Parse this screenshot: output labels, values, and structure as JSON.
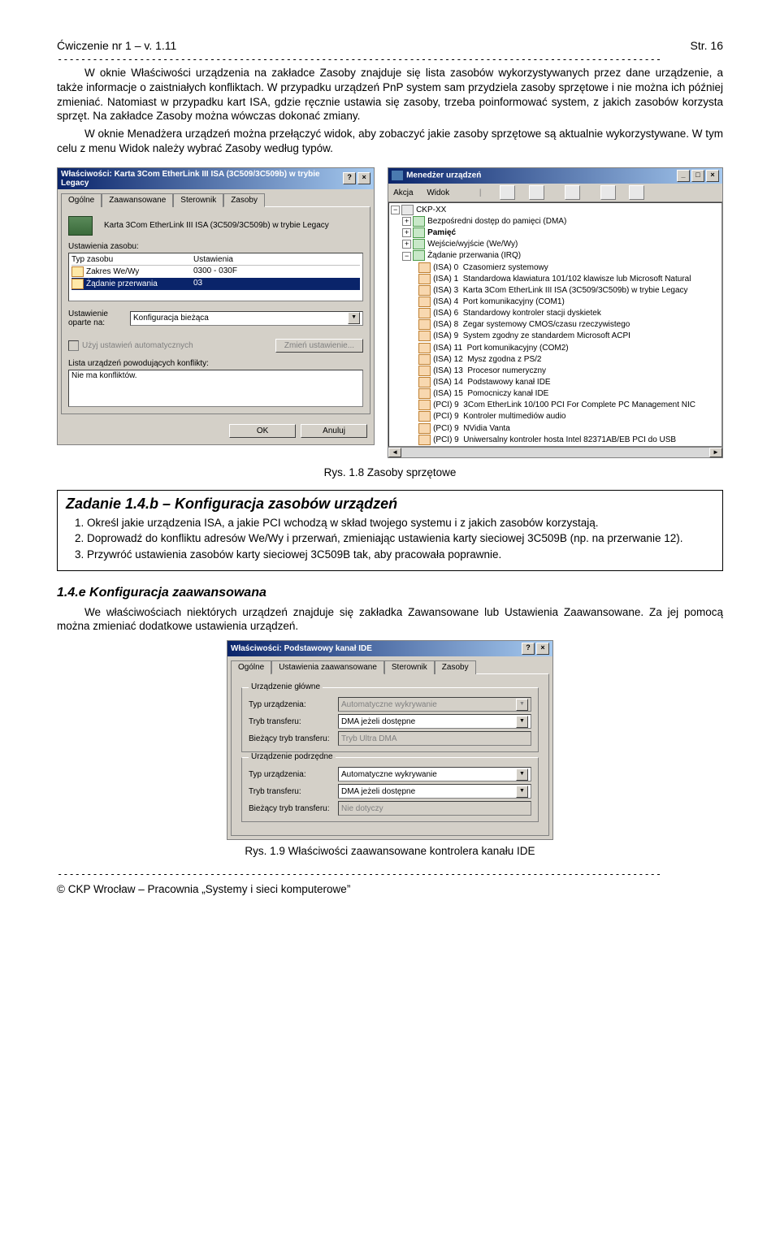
{
  "header": {
    "left": "Ćwiczenie nr 1 – v. 1.11",
    "right": "Str. 16"
  },
  "p1": "W oknie Właściwości urządzenia na zakładce Zasoby znajduje się lista zasobów wykorzystywanych przez dane urządzenie, a także informacje o zaistniałych konfliktach. W przypadku urządzeń PnP system sam przydziela zasoby sprzętowe i nie można ich później zmieniać. Natomiast w przypadku kart ISA, gdzie ręcznie ustawia się zasoby, trzeba poinformować system, z jakich zasobów korzysta sprzęt. Na zakładce Zasoby można wówczas dokonać zmiany.",
  "p2": "W oknie Menadżera urządzeń można przełączyć widok, aby zobaczyć jakie zasoby sprzętowe są aktualnie wykorzystywane. W tym celu z menu Widok należy wybrać Zasoby według typów.",
  "propsWin": {
    "title": "Właściwości: Karta 3Com EtherLink III ISA (3C509/3C509b) w trybie Legacy",
    "tabs": [
      "Ogólne",
      "Zaawansowane",
      "Sterownik",
      "Zasoby"
    ],
    "device": "Karta 3Com EtherLink III ISA (3C509/3C509b) w trybie Legacy",
    "resLabel": "Ustawienia zasobu:",
    "col1": "Typ zasobu",
    "col2": "Ustawienia",
    "r1a": "Zakres We/Wy",
    "r1b": "0300 - 030F",
    "r2a": "Żądanie przerwania",
    "r2b": "03",
    "baseLabel": "Ustawienie oparte na:",
    "baseVal": "Konfiguracja bieżąca",
    "autoChk": "Użyj ustawień automatycznych",
    "changeBtn": "Zmień ustawienie...",
    "conflictsLabel": "Lista urządzeń powodujących konflikty:",
    "conflictsVal": "Nie ma konfliktów.",
    "ok": "OK",
    "cancel": "Anuluj"
  },
  "mgrWin": {
    "title": "Menedżer urządzeń",
    "menu": [
      "Akcja",
      "Widok"
    ],
    "root": "CKP-XX",
    "nodes": [
      "Bezpośredni dostęp do pamięci (DMA)",
      "Pamięć",
      "Wejście/wyjście (We/Wy)",
      "Żądanie przerwania (IRQ)"
    ],
    "irq": [
      {
        "n": "(ISA) 0",
        "t": "Czasomierz systemowy"
      },
      {
        "n": "(ISA) 1",
        "t": "Standardowa klawiatura 101/102 klawisze lub Microsoft Natural"
      },
      {
        "n": "(ISA) 3",
        "t": "Karta 3Com EtherLink III ISA (3C509/3C509b) w trybie Legacy"
      },
      {
        "n": "(ISA) 4",
        "t": "Port komunikacyjny (COM1)"
      },
      {
        "n": "(ISA) 6",
        "t": "Standardowy kontroler stacji dyskietek"
      },
      {
        "n": "(ISA) 8",
        "t": "Zegar systemowy CMOS/czasu rzeczywistego"
      },
      {
        "n": "(ISA) 9",
        "t": "System zgodny ze standardem Microsoft ACPI"
      },
      {
        "n": "(ISA) 11",
        "t": "Port komunikacyjny (COM2)"
      },
      {
        "n": "(ISA) 12",
        "t": "Mysz zgodna z PS/2"
      },
      {
        "n": "(ISA) 13",
        "t": "Procesor numeryczny"
      },
      {
        "n": "(ISA) 14",
        "t": "Podstawowy kanał IDE"
      },
      {
        "n": "(ISA) 15",
        "t": "Pomocniczy kanał IDE"
      },
      {
        "n": "(PCI) 9",
        "t": "3Com EtherLink 10/100 PCI For Complete PC Management NIC"
      },
      {
        "n": "(PCI) 9",
        "t": "Kontroler multimediów audio"
      },
      {
        "n": "(PCI) 9",
        "t": "NVidia Vanta"
      },
      {
        "n": "(PCI) 9",
        "t": "Uniwersalny kontroler hosta Intel 82371AB/EB PCI do USB"
      }
    ]
  },
  "caption1": "Rys. 1.8 Zasoby sprzętowe",
  "task": {
    "title": "Zadanie 1.4.b – Konfiguracja zasobów urządzeń",
    "items": [
      "Określ jakie urządzenia ISA, a jakie PCI wchodzą w skład twojego systemu i z jakich zasobów korzystają.",
      "Doprowadź do konfliktu adresów We/Wy i przerwań, zmieniając ustawienia karty sieciowej 3C509B (np. na przerwanie 12).",
      "Przywróć ustawienia zasobów karty sieciowej 3C509B tak, aby pracowała poprawnie."
    ]
  },
  "sec": {
    "title": "1.4.e   Konfiguracja zaawansowana"
  },
  "p3": "We właściwościach niektórych urządzeń znajduje się zakładka Zawansowane lub Ustawienia Zaawansowane. Za jej pomocą można zmieniać dodatkowe ustawienia urządzeń.",
  "advWin": {
    "title": "Właściwości: Podstawowy kanał IDE",
    "tabs": [
      "Ogólne",
      "Ustawienia zaawansowane",
      "Sterownik",
      "Zasoby"
    ],
    "g1": "Urządzenie główne",
    "g2": "Urządzenie podrzędne",
    "f1l": "Typ urządzenia:",
    "f1v": "Automatyczne wykrywanie",
    "f2l": "Tryb transferu:",
    "f2v": "DMA jeżeli dostępne",
    "f3l": "Bieżący tryb transferu:",
    "f3v": "Tryb Ultra DMA",
    "f4v": "Automatyczne wykrywanie",
    "f5v": "DMA jeżeli dostępne",
    "f6v": "Nie dotyczy"
  },
  "caption2": "Rys. 1.9 Właściwości zaawansowane kontrolera kanału IDE",
  "footer": "© CKP Wrocław – Pracownia „Systemy i sieci komputerowe”"
}
